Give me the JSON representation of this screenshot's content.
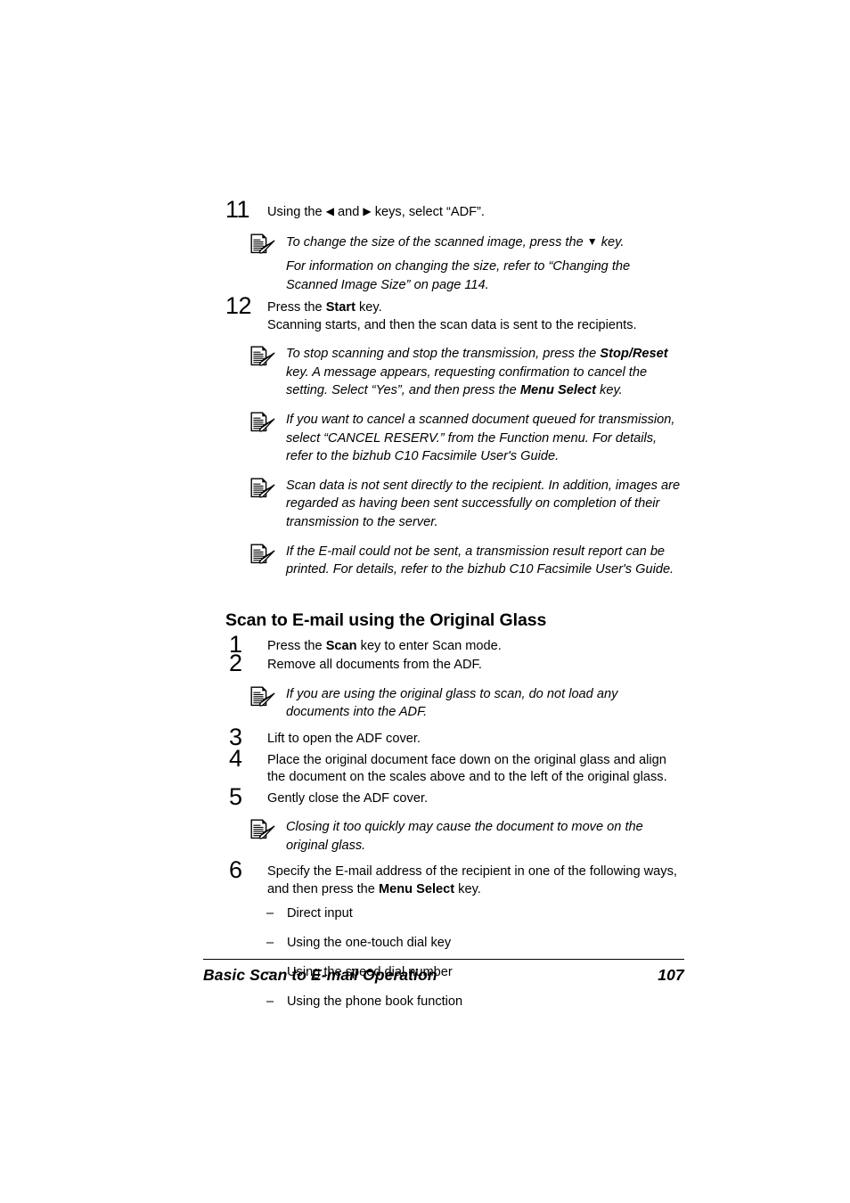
{
  "document": {
    "type": "printer-user-guide-page",
    "footer": {
      "title": "Basic Scan to E-mail Operation",
      "page_number": "107"
    }
  },
  "blocks": [
    {
      "kind": "step",
      "number": "11",
      "text_before": "Using the ",
      "glyph_left": "◀",
      "text_mid": " and ",
      "glyph_right": "▶",
      "text_after": " keys, select “ADF”.",
      "full_text": "Using the ◀ and ▶ keys, select “ADF”."
    },
    {
      "kind": "note",
      "icon": "note-pen-icon",
      "paragraph_1_before": "To change the size of the scanned image, press the ",
      "paragraph_1_glyph": "▼",
      "paragraph_1_after": " key.",
      "paragraph_2": "For information on changing the size, refer to “Changing the Scanned Image Size” on page 114."
    },
    {
      "kind": "step",
      "number": "12",
      "line_1_before": "Press the ",
      "line_1_bold": "Start",
      "line_1_after": " key.",
      "line_2": "Scanning starts, and then the scan data is sent to the recipients."
    },
    {
      "kind": "note",
      "icon": "note-pen-icon",
      "segments": [
        {
          "text": "To stop scanning and stop the transmission, press the ",
          "bold": false
        },
        {
          "text": "Stop/Reset",
          "bold": true
        },
        {
          "text": " key. A message appears, requesting confirmation to cancel the setting. Select “Yes”, and then press the ",
          "bold": false
        },
        {
          "text": "Menu Select",
          "bold": true
        },
        {
          "text": " key.",
          "bold": false
        }
      ],
      "plain_text": "To stop scanning and stop the transmission, press the Stop/Reset key. A message appears, requesting confirmation to cancel the setting. Select “Yes”, and then press the Menu Select key."
    },
    {
      "kind": "note",
      "icon": "note-pen-icon",
      "plain_text": "If you want to cancel a scanned document queued for transmission, select “CANCEL RESERV.” from the Function menu. For details, refer to the bizhub C10 Facsimile User's Guide."
    },
    {
      "kind": "note",
      "icon": "note-pen-icon",
      "plain_text": "Scan data is not sent directly to the recipient. In addition, images are regarded as having been sent successfully on completion of their transmission to the server."
    },
    {
      "kind": "note",
      "icon": "note-pen-icon",
      "plain_text": "If the E-mail could not be sent, a transmission result report can be printed. For details, refer to the bizhub C10 Facsimile User's Guide."
    },
    {
      "kind": "heading",
      "text": "Scan to E-mail using the Original Glass"
    },
    {
      "kind": "step",
      "number": "1",
      "line_1_before": "Press the ",
      "line_1_bold": "Scan",
      "line_1_after": " key to enter Scan mode."
    },
    {
      "kind": "step",
      "number": "2",
      "plain_text": "Remove all documents from the ADF."
    },
    {
      "kind": "note",
      "icon": "note-pen-icon",
      "plain_text": "If you are using the original glass to scan, do not load any documents into the ADF."
    },
    {
      "kind": "step",
      "number": "3",
      "plain_text": "Lift to open the ADF cover."
    },
    {
      "kind": "step",
      "number": "4",
      "plain_text": "Place the original document face down on the original glass and align the document on the scales above and to the left of the original glass."
    },
    {
      "kind": "step",
      "number": "5",
      "plain_text": "Gently close the ADF cover."
    },
    {
      "kind": "note",
      "icon": "note-pen-icon",
      "plain_text": "Closing it too quickly may cause the document to move on the original glass."
    },
    {
      "kind": "step",
      "number": "6",
      "line_1_before": "Specify the E-mail address of the recipient in one of the following ways, and then press the ",
      "line_1_bold": "Menu Select",
      "line_1_after": " key."
    },
    {
      "kind": "dash-list",
      "items": [
        "Direct input",
        "Using the one-touch dial key",
        "Using the speed dial number",
        "Using the phone book function"
      ],
      "dash": "–"
    }
  ],
  "steps": {
    "s11": {
      "number": "11",
      "before": "Using the ",
      "left_arrow": "◀",
      "mid": " and ",
      "right_arrow": "▶",
      "after": " keys, select “ADF”."
    },
    "s12": {
      "number": "12",
      "before": "Press the ",
      "bold": "Start",
      "after": " key.",
      "second_line": "Scanning starts, and then the scan data is sent to the recipients."
    },
    "g1": {
      "number": "1",
      "before": "Press the ",
      "bold": "Scan",
      "after": " key to enter Scan mode."
    },
    "g2": {
      "number": "2",
      "text": "Remove all documents from the ADF."
    },
    "g3": {
      "number": "3",
      "text": "Lift to open the ADF cover."
    },
    "g4": {
      "number": "4",
      "text": "Place the original document face down on the original glass and align the document on the scales above and to the left of the original glass."
    },
    "g5": {
      "number": "5",
      "text": "Gently close the ADF cover."
    },
    "g6": {
      "number": "6",
      "before": "Specify the E-mail address of the recipient in one of the following ways, and then press the ",
      "bold": "Menu Select",
      "after": " key."
    }
  },
  "notes": {
    "n1": {
      "p1_before": "To change the size of the scanned image, press the ",
      "p1_glyph": "▼",
      "p1_after": " key.",
      "p2": "For information on changing the size, refer to “Changing the Scanned Image Size” on page 114."
    },
    "n2": {
      "a": "To stop scanning and stop the transmission, press the ",
      "b1": "Stop/Reset",
      "b": " key. A message appears, requesting confirmation to cancel the setting. Select “Yes”, and then press the ",
      "b2": "Menu Select",
      "c": " key."
    },
    "n3": {
      "text": "If you want to cancel a scanned document queued for transmission, select “CANCEL RESERV.” from the Function menu. For details, refer to the bizhub C10 Facsimile User's Guide."
    },
    "n4": {
      "text": "Scan data is not sent directly to the recipient. In addition, images are regarded as having been sent successfully on completion of their transmission to the server."
    },
    "n5": {
      "text": "If the E-mail could not be sent, a transmission result report can be printed. For details, refer to the bizhub C10 Facsimile User's Guide."
    },
    "n6": {
      "text": "If you are using the original glass to scan, do not load any documents into the ADF."
    },
    "n7": {
      "text": "Closing it too quickly may cause the document to move on the original glass."
    }
  },
  "heading": {
    "text": "Scan to E-mail using the Original Glass"
  },
  "dash_list": {
    "dash": "–",
    "items": [
      "Direct input",
      "Using the one-touch dial key",
      "Using the speed dial number",
      "Using the phone book function"
    ]
  },
  "footer": {
    "title": "Basic Scan to E-mail Operation",
    "page_number": "107"
  },
  "colors": {
    "text": "#000000",
    "background": "#ffffff"
  }
}
